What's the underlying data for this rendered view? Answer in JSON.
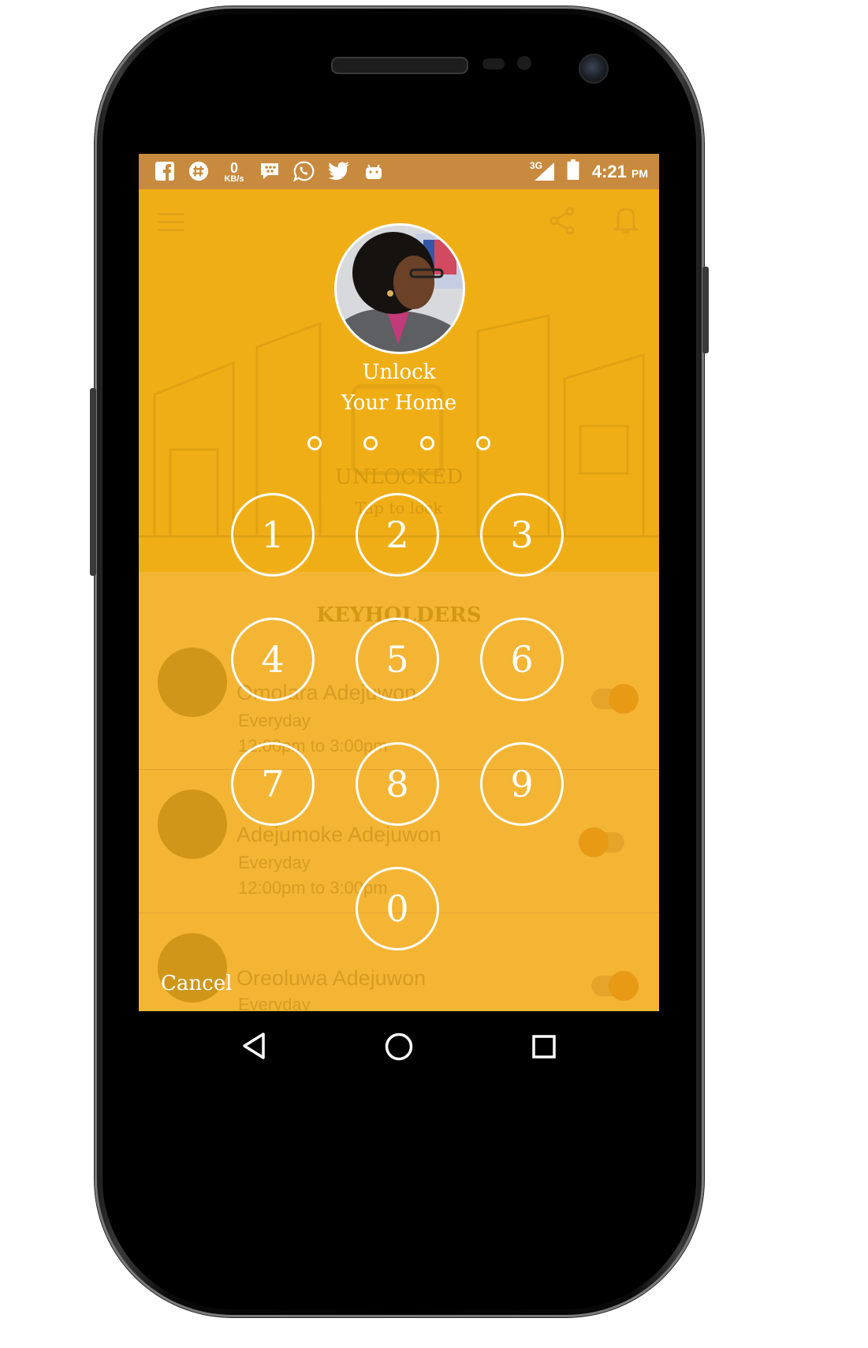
{
  "status_bar": {
    "time": "4:21",
    "ampm": "PM",
    "network": "3G",
    "data_rate_value": "0",
    "data_rate_unit": "KB/s",
    "icons": [
      "facebook-icon",
      "hash-icon",
      "data-rate-icon",
      "bbm-icon",
      "whatsapp-icon",
      "twitter-icon",
      "android-icon",
      "signal-icon",
      "battery-icon"
    ]
  },
  "lock_screen": {
    "title_line1": "Unlock",
    "title_line2": "Your Home",
    "pin_length": 4,
    "keys": [
      "1",
      "2",
      "3",
      "4",
      "5",
      "6",
      "7",
      "8",
      "9",
      "0"
    ],
    "cancel_label": "Cancel",
    "colors": {
      "overlay": "#f2b01e",
      "status_bar": "#c88a3e",
      "text": "#ffffff"
    }
  },
  "background_app": {
    "lock_status": "UNLOCKED",
    "lock_hint": "Tap to lock",
    "section_title": "KEYHOLDERS",
    "keyholders": [
      {
        "name": "Omolara Adejuwon",
        "days": "Everyday",
        "time": "12:00pm to 3:00pm",
        "enabled": true
      },
      {
        "name": "Adejumoke Adejuwon",
        "days": "Everyday",
        "time": "12:00pm to 3:00pm",
        "enabled": false
      },
      {
        "name": "Oreoluwa Adejuwon",
        "days": "Everyday",
        "time": "",
        "enabled": true
      }
    ]
  },
  "nav_bar": {
    "back": "back-icon",
    "home": "home-icon",
    "recents": "recents-icon"
  }
}
